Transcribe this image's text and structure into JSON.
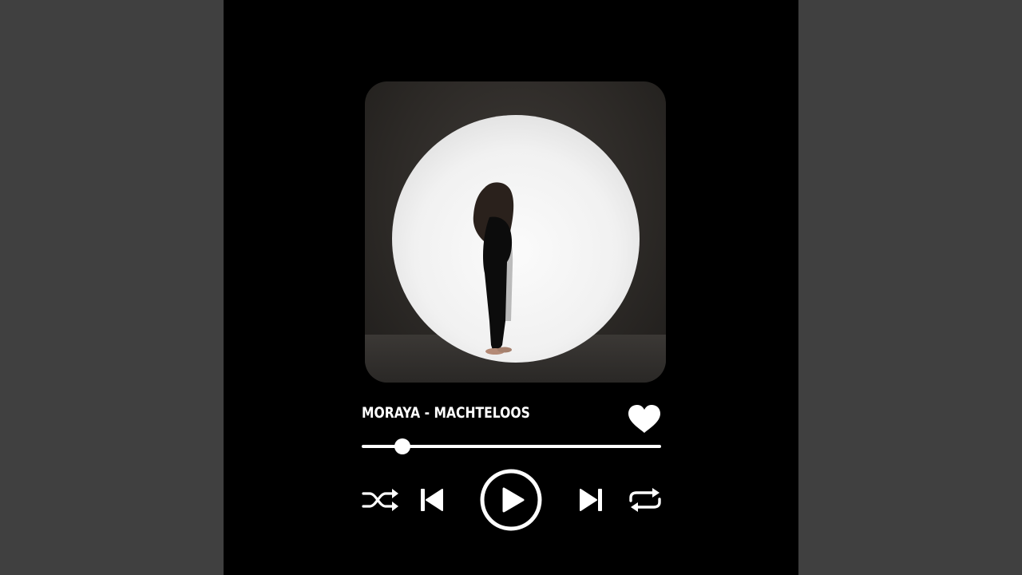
{
  "player": {
    "track_title": "MORAYA - MACHTELOOS",
    "liked": true,
    "progress_fraction": 0.135,
    "controls": {
      "shuffle_icon": "shuffle-icon",
      "previous_icon": "skip-previous-icon",
      "play_icon": "play-icon",
      "next_icon": "skip-next-icon",
      "repeat_icon": "repeat-icon",
      "like_icon": "heart-icon"
    }
  },
  "colors": {
    "page_background": "#404040",
    "player_background": "#000000",
    "foreground": "#ffffff"
  }
}
